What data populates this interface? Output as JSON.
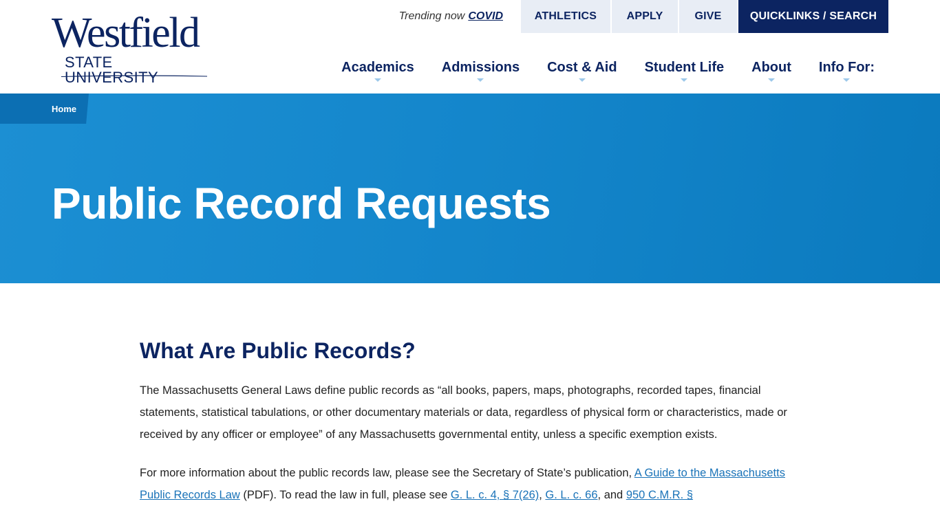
{
  "logo": {
    "main": "Westfield",
    "sub": "STATE UNIVERSITY",
    "color": "#0c2461"
  },
  "utility": {
    "trending_label": "Trending now",
    "trending_link": "COVID",
    "athletics": "ATHLETICS",
    "apply": "APPLY",
    "give": "GIVE",
    "quicklinks": "QUICKLINKS / SEARCH"
  },
  "nav": {
    "items": [
      {
        "label": "Academics"
      },
      {
        "label": "Admissions"
      },
      {
        "label": "Cost & Aid"
      },
      {
        "label": "Student Life"
      },
      {
        "label": "About"
      },
      {
        "label": "Info For:"
      }
    ]
  },
  "hero": {
    "breadcrumb_home": "Home",
    "title": "Public Record Requests",
    "color": "#1486cb"
  },
  "content": {
    "heading": "What Are Public Records?",
    "p1": "The Massachusetts General Laws define public records as “all books, papers, maps, photographs, recorded tapes, financial statements, statistical tabulations, or other documentary materials or data, regardless of physical form or characteristics, made or received by any officer or employee” of any Massachusetts governmental entity, unless a specific exemption exists.",
    "p2_pre": "For more information about the public records law, please see the Secretary of State’s publication, ",
    "p2_link1": "A Guide to the Massachusetts Public Records Law",
    "p2_mid1": " (PDF). To read the law in full, please see ",
    "p2_link2": "G. L. c. 4, § 7(26)",
    "p2_sep1": ", ",
    "p2_link3": "G. L. c. 66",
    "p2_sep2": ", and ",
    "p2_link4": "950 C.M.R. §"
  },
  "colors": {
    "navy": "#0c2461",
    "link": "#1a73b8",
    "utility_bg": "#e8edf5"
  }
}
